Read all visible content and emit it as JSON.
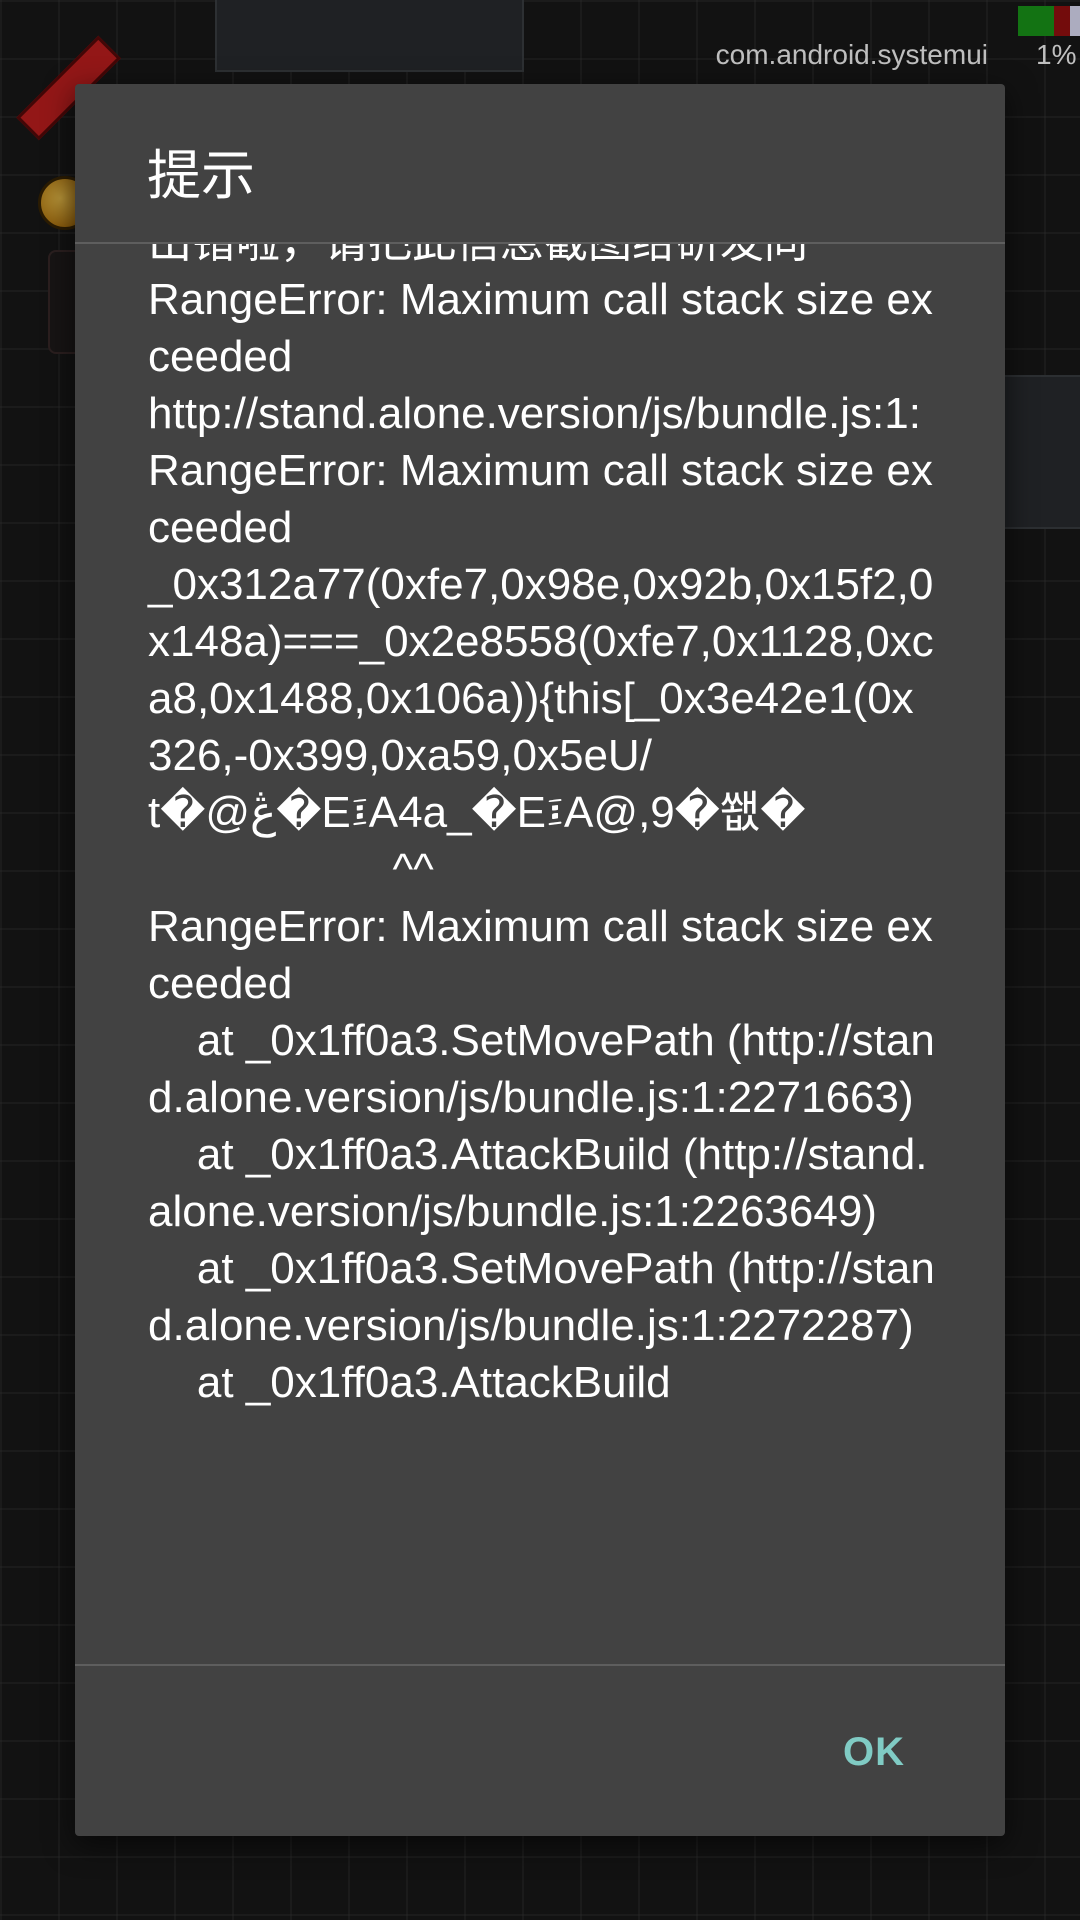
{
  "status_bar": {
    "app_name": "com.android.systemui",
    "percent": "1%"
  },
  "dialog": {
    "title": "提示",
    "message": "出错啦，请把此信息截图给研发同\nRangeError: Maximum call stack size exceeded\nhttp://stand.alone.version/js/bundle.js:1:\nRangeError: Maximum call stack size exceeded\n_0x312a77(0xfe7,0x98e,0x92b,0x15f2,0x148a)===_0x2e8558(0xfe7,0x1128,0xca8,0x1488,0x106a)){this[_0x3e42e1(0x326,-0x399,0xa59,0x5eU/\nt�@ڠ�E፤A4a_�E፤A@,9�쐢�\n                    ^^\nRangeError: Maximum call stack size exceeded\n    at _0x1ff0a3.SetMovePath (http://stand.alone.version/js/bundle.js:1:2271663)\n    at _0x1ff0a3.AttackBuild (http://stand.alone.version/js/bundle.js:1:2263649)\n    at _0x1ff0a3.SetMovePath (http://stand.alone.version/js/bundle.js:1:2272287)\n    at _0x1ff0a3.AttackBuild",
    "ok_label": "OK"
  },
  "colors": {
    "dialog_bg": "#424242",
    "accent": "#80cbc4"
  }
}
